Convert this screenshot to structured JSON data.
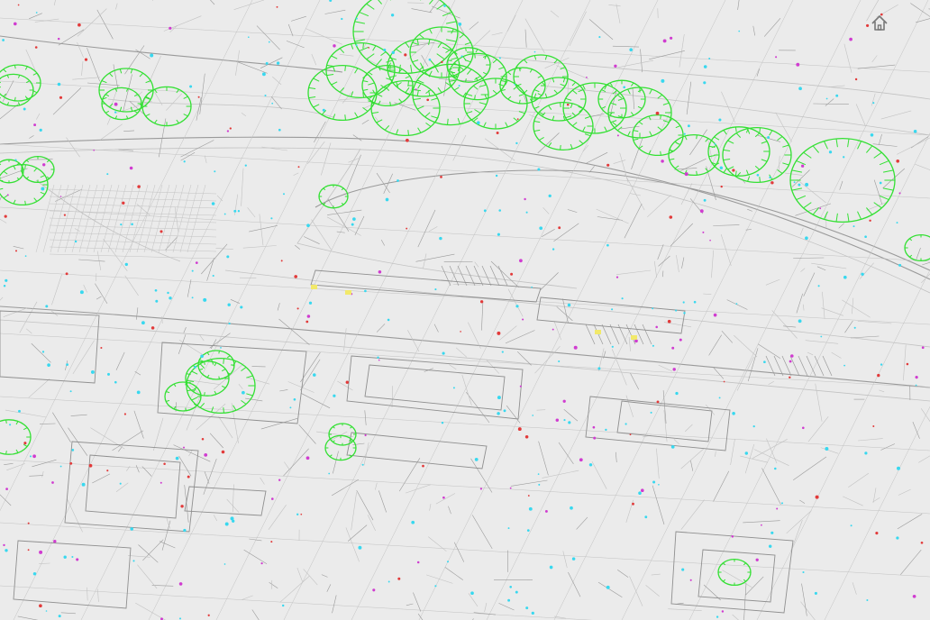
{
  "viewer": {
    "toolbar": {
      "home_icon": "home-icon"
    }
  },
  "colors": {
    "background": "#ebebeb",
    "linework": "#9a9a9a",
    "linework_light": "#c2c2c2",
    "trees": "#33e033",
    "markers_cyan": "#38d8ef",
    "markers_red": "#e23a3a",
    "markers_magenta": "#d03cd0",
    "markers_yellow": "#f2e96a"
  }
}
